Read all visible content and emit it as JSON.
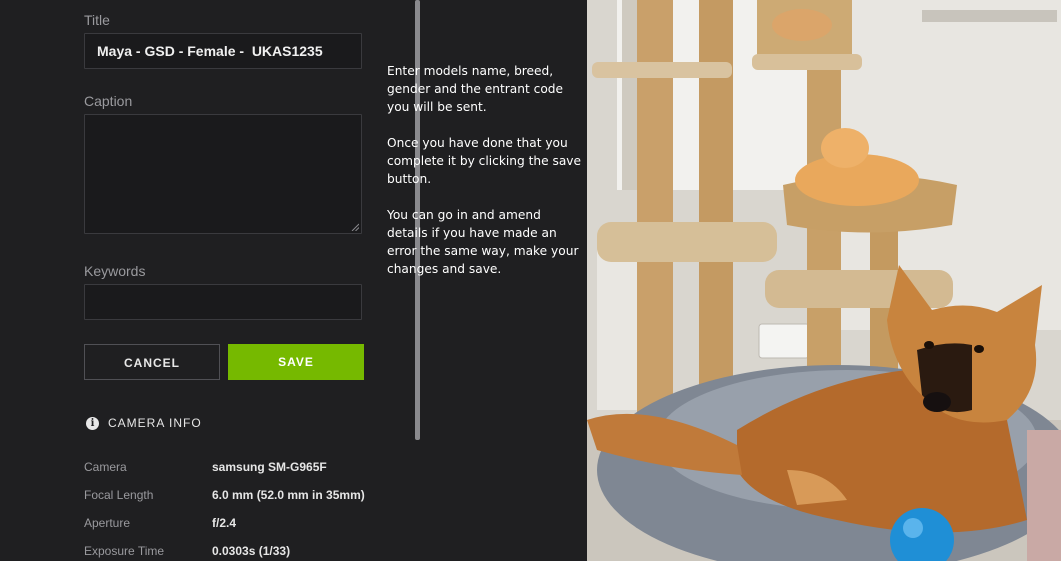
{
  "form": {
    "title_label": "Title",
    "title_value": "Maya - GSD - Female -  UKAS1235",
    "caption_label": "Caption",
    "caption_value": "",
    "keywords_label": "Keywords",
    "keywords_value": "",
    "cancel_label": "CANCEL",
    "save_label": "SAVE"
  },
  "camera_info": {
    "heading": "CAMERA INFO",
    "rows": [
      {
        "key": "Camera",
        "value": "samsung SM-G965F"
      },
      {
        "key": "Focal Length",
        "value": "6.0 mm (52.0 mm in 35mm)"
      },
      {
        "key": "Aperture",
        "value": "f/2.4"
      },
      {
        "key": "Exposure Time",
        "value": "0.0303s (1/33)"
      }
    ]
  },
  "help": {
    "p1": "Enter models name, breed, gender and the entrant code you will be sent.",
    "p2": "Once you have done that you complete it by clicking the save button.",
    "p3": "You can go in and amend details if you have made an error the same way, make your changes and save."
  },
  "colors": {
    "accent": "#76b900",
    "background": "#1f1f21"
  },
  "icons": {
    "info": "info-icon"
  }
}
